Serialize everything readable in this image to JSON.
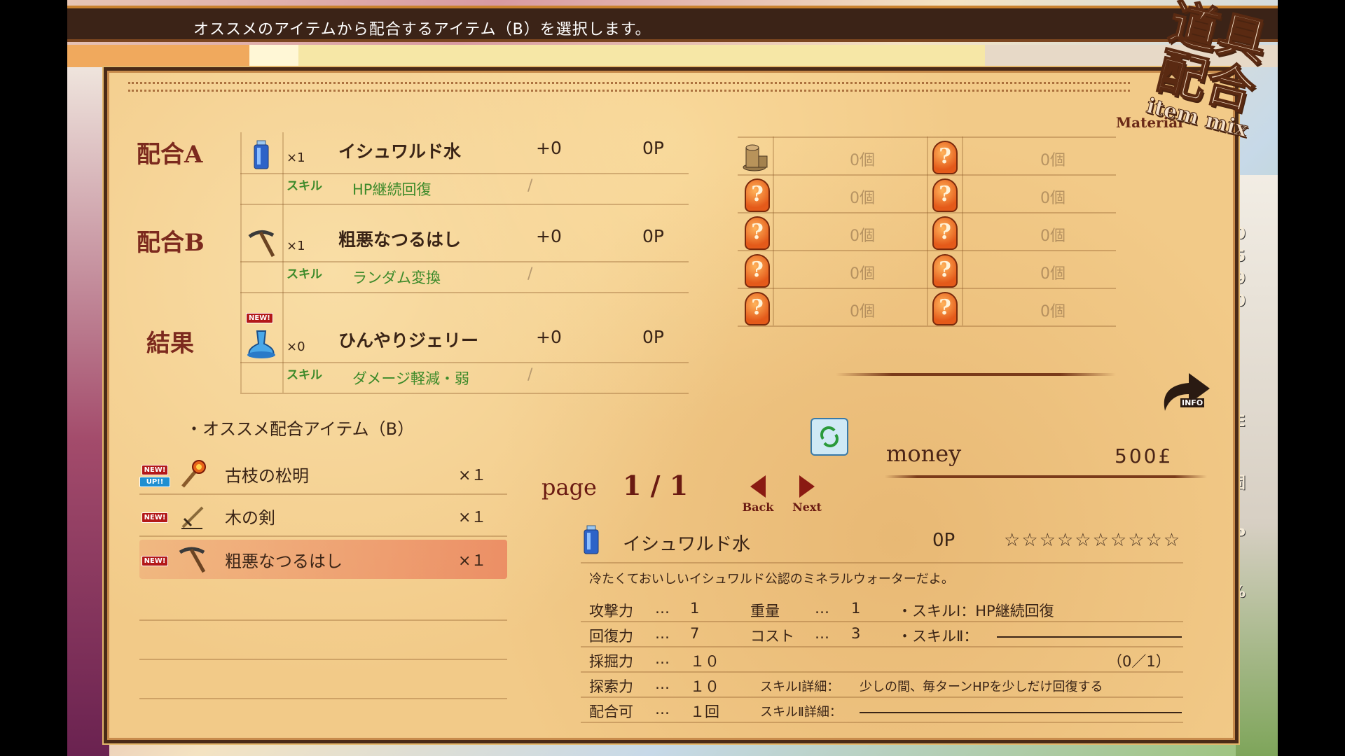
{
  "top_message": "オススメのアイテムから配合するアイテム（B）を選択します。",
  "logo": {
    "line1": "道具",
    "line2": "配合",
    "en": "item mix"
  },
  "right_fragments": [
    "0",
    "5",
    "9",
    "0",
    "E",
    "固",
    "P",
    "%"
  ],
  "mix": [
    {
      "label": "配合A",
      "icon": "water-bottle-icon",
      "qty": "×1",
      "name": "イシュワルド水",
      "plus": "+0",
      "points": "0P",
      "skill_label": "スキル",
      "skill": "HP継続回復",
      "slash": "/"
    },
    {
      "label": "配合B",
      "icon": "pickaxe-icon",
      "qty": "×1",
      "name": "粗悪なつるはし",
      "plus": "+0",
      "points": "0P",
      "skill_label": "スキル",
      "skill": "ランダム変換",
      "slash": "/"
    },
    {
      "label": "結果",
      "icon": "jelly-icon",
      "new": "NEW!",
      "qty": "×0",
      "name": "ひんやりジェリー",
      "plus": "+0",
      "points": "0P",
      "skill_label": "スキル",
      "skill": "ダメージ軽減・弱",
      "slash": "/"
    }
  ],
  "material": {
    "title": "Material",
    "rows": [
      {
        "left": "0個",
        "right": "0個"
      },
      {
        "left": "0個",
        "right": "0個"
      },
      {
        "left": "0個",
        "right": "0個"
      },
      {
        "left": "0個",
        "right": "0個"
      },
      {
        "left": "0個",
        "right": "0個"
      }
    ],
    "unknown_glyph": "?"
  },
  "recommend": {
    "title": "・オススメ配合アイテム（B）",
    "items": [
      {
        "new": "NEW!",
        "up": "UP!!",
        "icon": "torch-icon",
        "name": "古枝の松明",
        "qty": "×１"
      },
      {
        "new": "NEW!",
        "up": "",
        "icon": "wooden-sword-icon",
        "name": "木の剣",
        "qty": "×１"
      },
      {
        "new": "NEW!",
        "up": "",
        "icon": "pickaxe-icon",
        "name": "粗悪なつるはし",
        "qty": "×１"
      }
    ]
  },
  "pager": {
    "label": "page",
    "value": "1 / 1",
    "back": "Back",
    "next": "Next"
  },
  "money": {
    "label": "money",
    "value": "500£"
  },
  "info_label": "INFO",
  "detail": {
    "name": "イシュワルド水",
    "points": "0P",
    "rating": 0,
    "stars_total": 10,
    "star_glyph": "☆",
    "description": "冷たくておいしいイシュワルド公認のミネラルウォーターだよ。",
    "stats": [
      {
        "k": "攻撃力",
        "dots": "…",
        "v": "1"
      },
      {
        "k": "回復力",
        "dots": "…",
        "v": "7"
      },
      {
        "k": "採掘力",
        "dots": "…",
        "v": "１０"
      },
      {
        "k": "探索力",
        "dots": "…",
        "v": "１０"
      },
      {
        "k": "配合可",
        "dots": "…",
        "v": "１回"
      }
    ],
    "weight": {
      "k": "重量",
      "dots": "…",
      "v": "1"
    },
    "cost": {
      "k": "コスト",
      "dots": "…",
      "v": "3"
    },
    "skill1": "・スキルⅠ：HP継続回復",
    "skill2": "・スキルⅡ：",
    "skill_count": "（0／1）",
    "skill1_detail_label": "スキルⅠ詳細：",
    "skill1_detail": "少しの間、毎ターンHPを少しだけ回復する",
    "skill2_detail_label": "スキルⅡ詳細："
  }
}
